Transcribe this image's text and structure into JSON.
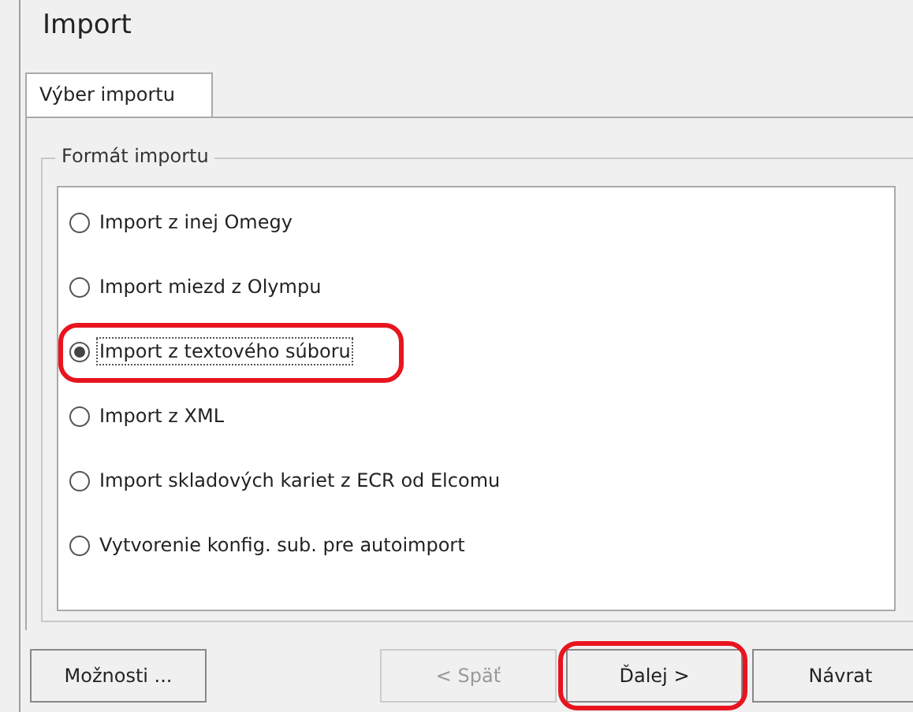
{
  "window": {
    "title": "Import"
  },
  "tabs": [
    {
      "label": "Výber importu",
      "selected": true
    }
  ],
  "group": {
    "title": "Formát importu",
    "options": [
      {
        "label": "Import z inej Omegy",
        "selected": false,
        "highlighted": false
      },
      {
        "label": "Import miezd z Olympu",
        "selected": false,
        "highlighted": false
      },
      {
        "label": "Import z textového súboru",
        "selected": true,
        "highlighted": true
      },
      {
        "label": "Import z XML",
        "selected": false,
        "highlighted": false
      },
      {
        "label": "Import skladových kariet z ECR od Elcomu",
        "selected": false,
        "highlighted": false
      },
      {
        "label": "Vytvorenie konfig. sub. pre autoimport",
        "selected": false,
        "highlighted": false
      }
    ]
  },
  "buttons": [
    {
      "label": "Možnosti ...",
      "disabled": false,
      "highlighted": false,
      "kind": "left"
    },
    {
      "label": "< Späť",
      "disabled": true,
      "highlighted": false,
      "kind": "right"
    },
    {
      "label": "Ďalej >",
      "disabled": false,
      "highlighted": true,
      "kind": "right"
    },
    {
      "label": "Návrat",
      "disabled": false,
      "highlighted": false,
      "kind": "right"
    }
  ]
}
